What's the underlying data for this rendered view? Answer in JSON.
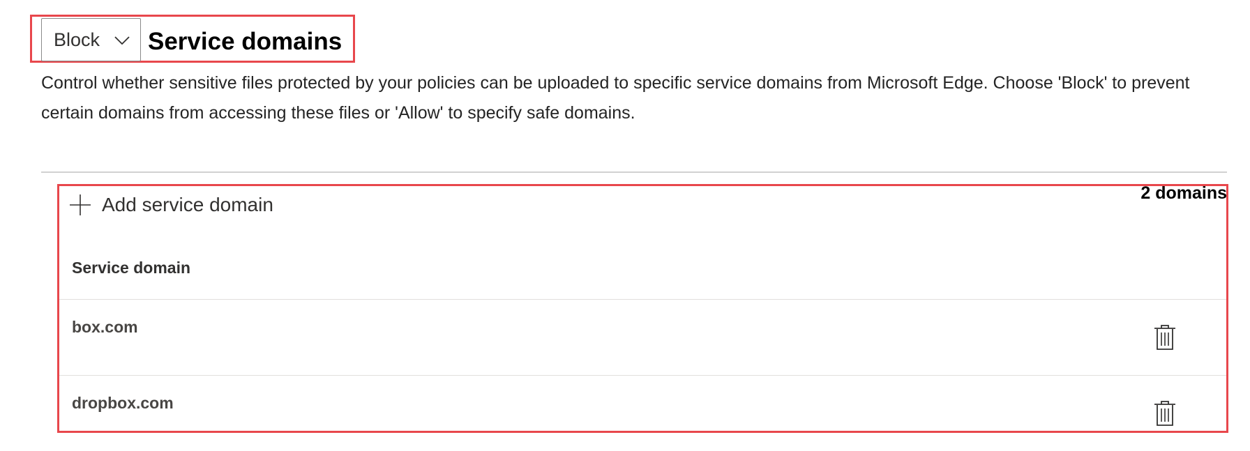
{
  "header": {
    "mode_dropdown": {
      "selected": "Block",
      "icon": "chevron-down-icon"
    },
    "title": "Service domains",
    "description": "Control whether sensitive files protected by your policies can be uploaded to specific service domains from Microsoft Edge. Choose 'Block' to prevent certain domains from accessing these files or 'Allow' to specify safe domains."
  },
  "list": {
    "add_button": {
      "label": "Add service domain",
      "icon": "plus-icon"
    },
    "count_label": "2 domains",
    "column_header": "Service domain",
    "rows": [
      {
        "domain": "box.com",
        "action_icon": "trash-icon"
      },
      {
        "domain": "dropbox.com",
        "action_icon": "trash-icon"
      }
    ]
  },
  "colors": {
    "highlight": "#e8474c",
    "divider": "#d1d1d1",
    "row_separator": "#e1dfdd",
    "text_primary": "#242424",
    "text_secondary": "#484644"
  }
}
